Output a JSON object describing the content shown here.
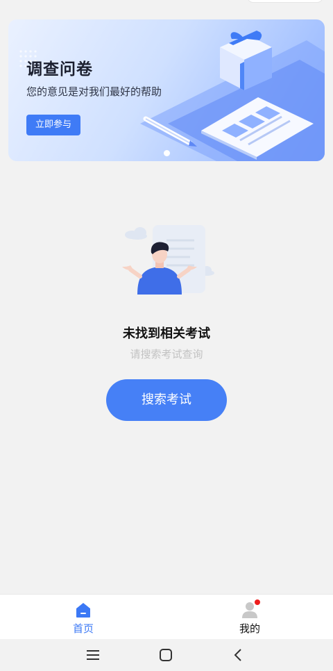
{
  "banner": {
    "title": "调查问卷",
    "subtitle": "您的意见是对我们最好的帮助",
    "button_label": "立即参与",
    "page_count": 1,
    "active_page": 1
  },
  "empty_state": {
    "title": "未找到相关考试",
    "subtitle": "请搜索考试查询",
    "button_label": "搜索考试"
  },
  "tabbar": {
    "items": [
      {
        "label": "首页",
        "icon": "home-icon",
        "active": true
      },
      {
        "label": "我的",
        "icon": "user-icon",
        "active": false,
        "has_badge": true
      }
    ]
  },
  "system_nav": {
    "buttons": [
      "menu-icon",
      "home-square-icon",
      "back-chevron-icon"
    ]
  },
  "colors": {
    "accent": "#4680f6",
    "background": "#f2f2f2",
    "badge": "#ee1d1d"
  }
}
